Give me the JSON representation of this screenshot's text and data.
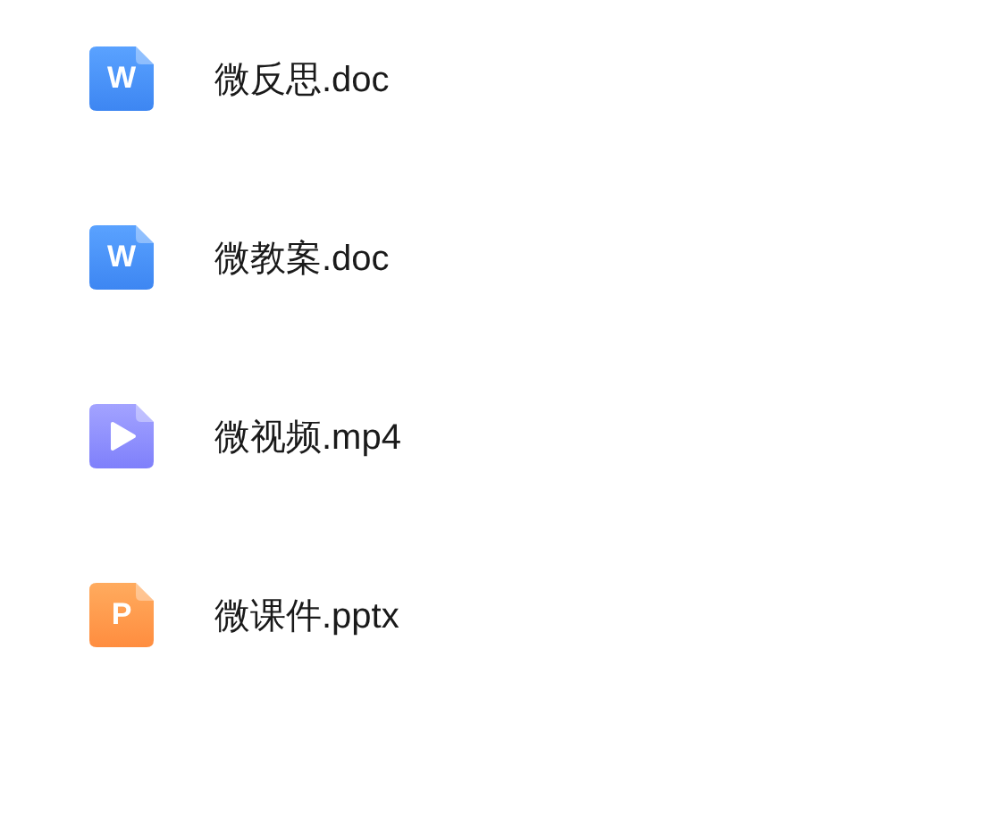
{
  "files": [
    {
      "kind": "word",
      "letter": "W",
      "name": "微反思.doc"
    },
    {
      "kind": "word",
      "letter": "W",
      "name": "微教案.doc"
    },
    {
      "kind": "video",
      "name": "微视频.mp4"
    },
    {
      "kind": "ppt",
      "letter": "P",
      "name": "微课件.pptx"
    }
  ]
}
